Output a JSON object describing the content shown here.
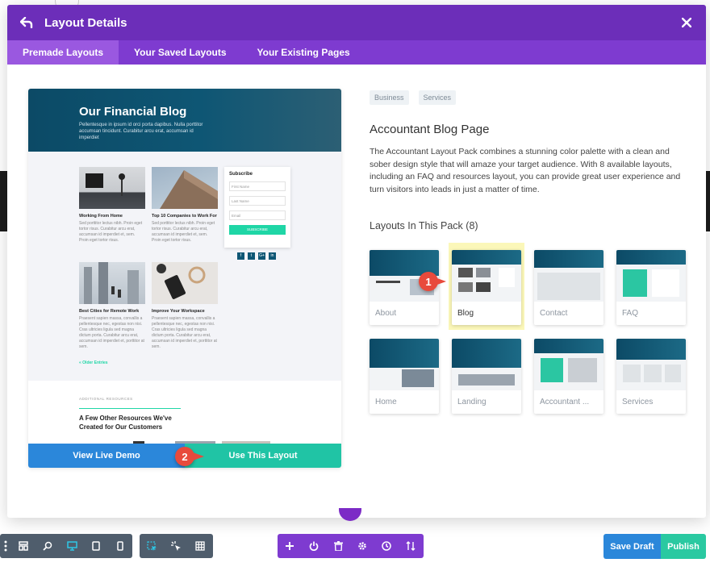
{
  "modal": {
    "title": "Layout Details",
    "tabs": [
      {
        "label": "Premade Layouts",
        "active": true
      },
      {
        "label": "Your Saved Layouts",
        "active": false
      },
      {
        "label": "Your Existing Pages",
        "active": false
      }
    ]
  },
  "preview": {
    "hero_title": "Our Financial Blog",
    "hero_text": "Pellentesque in ipsum id orci porta dapibus. Nulla porttitor accumsan tincidunt. Curabitur arcu erat, accumsan id imperdiet",
    "cards": [
      {
        "title": "Working From Home",
        "text": "Sed porttitor lectus nibh. Proin eget tortor risus. Curabitur arcu erat, accumsan id imperdiet et, sem. Proin eget tortor risus."
      },
      {
        "title": "Top 10 Companies to Work For",
        "text": "Sed porttitor lectus nibh. Proin eget tortor risus. Curabitur arcu erat, accumsan id imperdiet et, sem. Proin eget tortor risus."
      },
      {
        "title": "Best Cities for Remote Work",
        "text": "Praesent sapien massa, convallis a pellentesque nec, egestas non nisi. Cras ultricies ligula sed magna dictum porta. Curabitur arcu erat, accumsan id imperdiet et, porttitor at sem."
      },
      {
        "title": "Improve Your Workspace",
        "text": "Praesent sapien massa, convallis a pellentesque nec, egestas non nisi. Cras ultricies ligula sed magna dictum porta. Curabitur arcu erat, accumsan id imperdiet et, porttitor at sem."
      }
    ],
    "subscribe": {
      "title": "Subscribe",
      "fields": [
        "First Name",
        "Last Name",
        "Email"
      ],
      "button": "SUBSCRIBE"
    },
    "social": [
      "f",
      "t",
      "G+",
      "in"
    ],
    "older_link": "« Older Entries",
    "lower_label": "ADDITIONAL RESOURCES",
    "lower_title": "A Few Other Resources We've Created for Our Customers",
    "view_demo_label": "View Live Demo",
    "use_layout_label": "Use This Layout"
  },
  "details": {
    "tags": [
      "Business",
      "Services"
    ],
    "title": "Accountant Blog Page",
    "description": "The Accountant Layout Pack combines a stunning color palette with a clean and sober design style that will amaze your target audience. With 8 available layouts, including an FAQ and resources layout, you can provide great user experience and turn visitors into leads in just a matter of time.",
    "pack_title": "Layouts In This Pack (8)",
    "layouts": [
      {
        "label": "About",
        "active": false
      },
      {
        "label": "Blog",
        "active": true
      },
      {
        "label": "Contact",
        "active": false
      },
      {
        "label": "FAQ",
        "active": false
      },
      {
        "label": "Home",
        "active": false
      },
      {
        "label": "Landing",
        "active": false
      },
      {
        "label": "Accountant ...",
        "active": false
      },
      {
        "label": "Services",
        "active": false
      }
    ]
  },
  "annotations": {
    "marker_1": "1",
    "marker_2": "2"
  },
  "toolbar": {
    "left_icons": [
      "more-vertical-icon",
      "wireframe-icon",
      "zoom-icon",
      "desktop-icon",
      "tablet-icon",
      "phone-icon"
    ],
    "mid_icons": [
      "click-mode-icon",
      "hover-mode-icon",
      "grid-icon"
    ],
    "center_icons": [
      "add-icon",
      "power-icon",
      "trash-icon",
      "settings-icon",
      "history-icon",
      "sort-icon"
    ],
    "save_draft": "Save Draft",
    "publish": "Publish"
  },
  "colors": {
    "header": "#6c2eb9",
    "tabs": "#7e3bd0",
    "demo_button": "#2b87da",
    "use_button": "#20c4a5",
    "marker": "#e84a3c",
    "highlight": "#fbf7b9"
  }
}
